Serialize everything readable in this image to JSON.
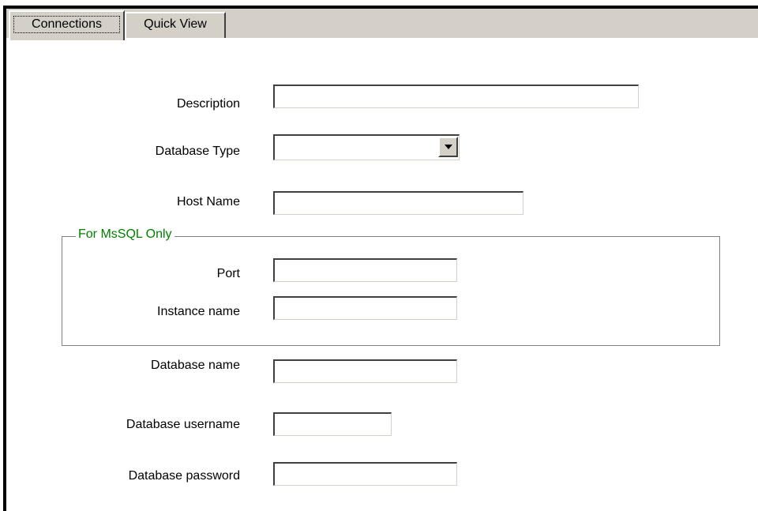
{
  "tabs": [
    {
      "label": "Connections",
      "active": true
    },
    {
      "label": "Quick View",
      "active": false
    }
  ],
  "form": {
    "description": {
      "label": "Description",
      "value": ""
    },
    "database_type": {
      "label": "Database Type",
      "selected": ""
    },
    "host_name": {
      "label": "Host Name",
      "value": ""
    },
    "mssql_group": {
      "title": "For MsSQL Only",
      "title_color": "#008000",
      "port": {
        "label": "Port",
        "value": ""
      },
      "instance_name": {
        "label": "Instance name",
        "value": ""
      }
    },
    "database_name": {
      "label": "Database name",
      "value": ""
    },
    "database_username": {
      "label": "Database username",
      "value": ""
    },
    "database_password": {
      "label": "Database password",
      "value": ""
    }
  },
  "colors": {
    "window_frame": "#000000",
    "tab_background": "#d4d0c8",
    "panel_background": "#ffffff",
    "group_title": "#008000"
  }
}
